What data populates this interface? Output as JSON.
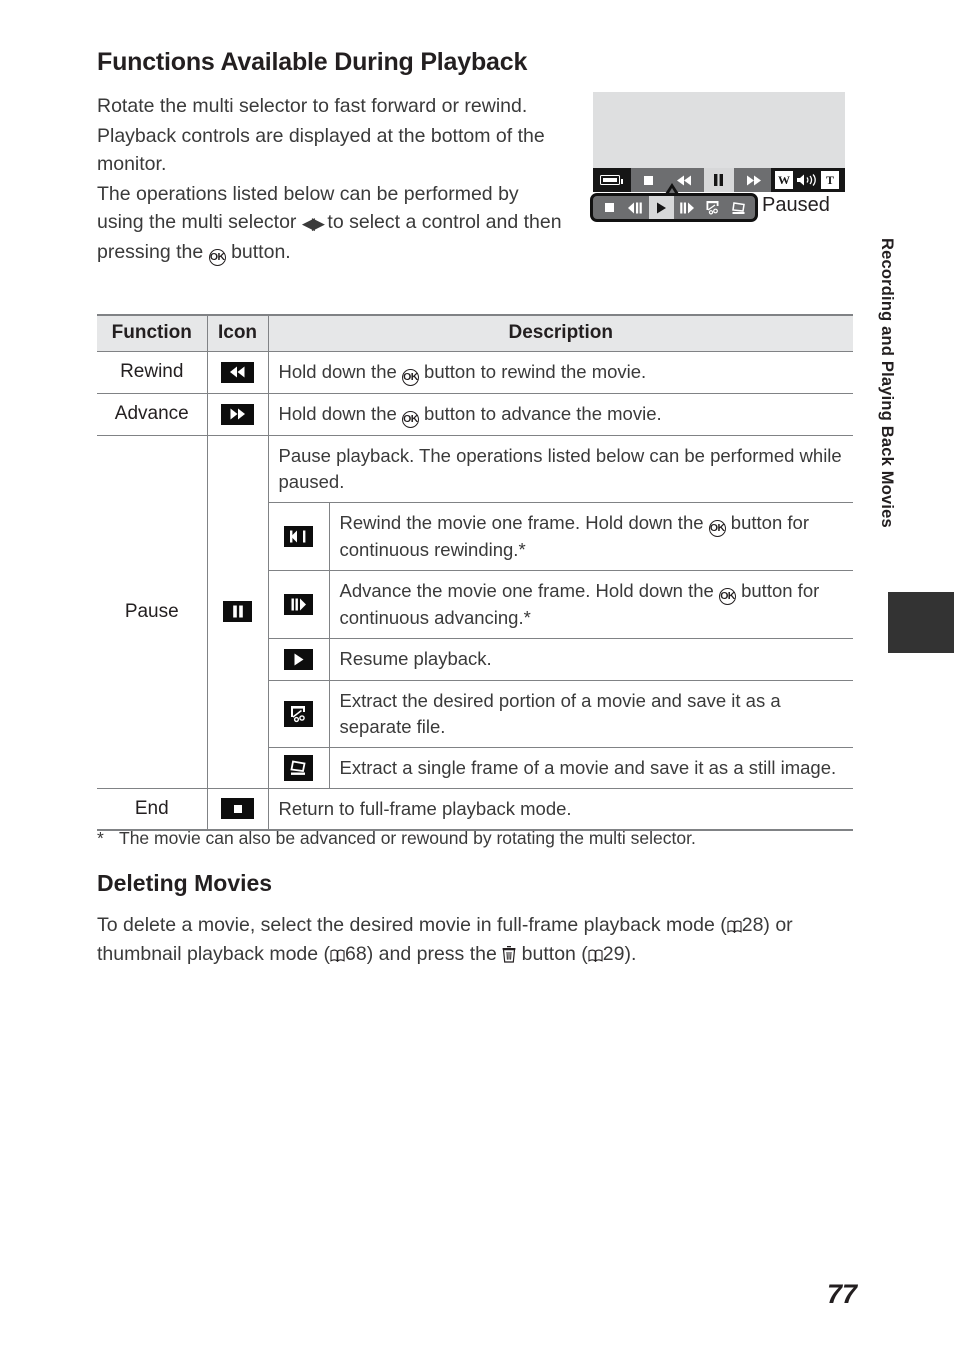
{
  "heading": "Functions Available During Playback",
  "intro": {
    "p1_a": "Rotate the multi selector to fast forward or rewind.",
    "p2_a": "Playback controls are displayed at the bottom of the monitor.",
    "p3_a": "The operations listed below can be performed by using the multi selector ",
    "p3_b": " to select a control and then pressing the ",
    "p3_c": " button.",
    "ok_label": "OK"
  },
  "illustration": {
    "battery_icon": "battery-icon",
    "monitor_controls": [
      {
        "name": "stop-icon",
        "glyph": "stop",
        "selected": false
      },
      {
        "name": "rewind-icon",
        "glyph": "rewind",
        "selected": false
      },
      {
        "name": "pause-icon",
        "glyph": "pause",
        "selected": true
      },
      {
        "name": "advance-icon",
        "glyph": "advance",
        "selected": false
      }
    ],
    "volume": {
      "wide_label": "W",
      "tele_label": "T",
      "speaker_icon": "speaker-icon"
    },
    "callout_controls": [
      {
        "name": "stop-icon",
        "glyph": "stop",
        "selected": false
      },
      {
        "name": "frame-rewind-icon",
        "glyph": "frame-rewind",
        "selected": false
      },
      {
        "name": "play-icon",
        "glyph": "play",
        "selected": true
      },
      {
        "name": "frame-advance-icon",
        "glyph": "frame-advance",
        "selected": false
      },
      {
        "name": "movie-edit-icon",
        "glyph": "movie-edit",
        "selected": false
      },
      {
        "name": "frame-extract-icon",
        "glyph": "frame-extract",
        "selected": false
      }
    ],
    "caption": "Paused"
  },
  "table": {
    "headers": {
      "function": "Function",
      "icon": "Icon",
      "description": "Description"
    },
    "rows": [
      {
        "function": "Rewind",
        "icon": "rewind-icon",
        "desc_a": "Hold down the ",
        "desc_b": " button to rewind the movie."
      },
      {
        "function": "Advance",
        "icon": "advance-icon",
        "desc_a": "Hold down the ",
        "desc_b": " button to advance the movie."
      }
    ],
    "pause": {
      "function": "Pause",
      "icon": "pause-icon",
      "lead_desc": "Pause playback. The operations listed below can be performed while paused.",
      "subrows": [
        {
          "icon": "frame-rewind-icon",
          "desc_a": "Rewind the movie one frame. Hold down the ",
          "desc_b": " button for continuous rewinding.*"
        },
        {
          "icon": "frame-advance-icon",
          "desc_a": "Advance the movie one frame. Hold down the ",
          "desc_b": " button for continuous advancing.*"
        },
        {
          "icon": "play-icon",
          "desc_a": "Resume playback.",
          "desc_b": ""
        },
        {
          "icon": "movie-edit-icon",
          "desc_a": "Extract the desired portion of a movie and save it as a separate file.",
          "desc_b": ""
        },
        {
          "icon": "frame-extract-icon",
          "desc_a": "Extract a single frame of a movie and save it as a still image.",
          "desc_b": ""
        }
      ]
    },
    "end": {
      "function": "End",
      "icon": "stop-icon",
      "desc_a": "Return to full-frame playback mode.",
      "desc_b": ""
    }
  },
  "footnote": {
    "marker": "*",
    "text": "The movie can also be advanced or rewound by rotating the multi selector."
  },
  "section2": {
    "heading": "Deleting Movies",
    "body_a": "To delete a movie, select the desired movie in full-frame playback mode (",
    "ref1": "28",
    "body_b": ") or thumbnail playback mode (",
    "ref2": "68",
    "body_c": ") and press the ",
    "body_d": " button (",
    "ref3": "29",
    "body_e": ")."
  },
  "side_tab": {
    "label": "Recording and Playing Back Movies"
  },
  "page_number": "77",
  "colors": {
    "text": "#231f20",
    "body_text": "#3a3a3a",
    "rule": "#808285",
    "header_fill": "#e6e7e8",
    "lcd_screen": "#dedfe0",
    "lcd_bar": "#161616",
    "panel_gray": "#6d6e70",
    "selected_gray": "#d7d8d9",
    "tab_mark": "#333333"
  }
}
